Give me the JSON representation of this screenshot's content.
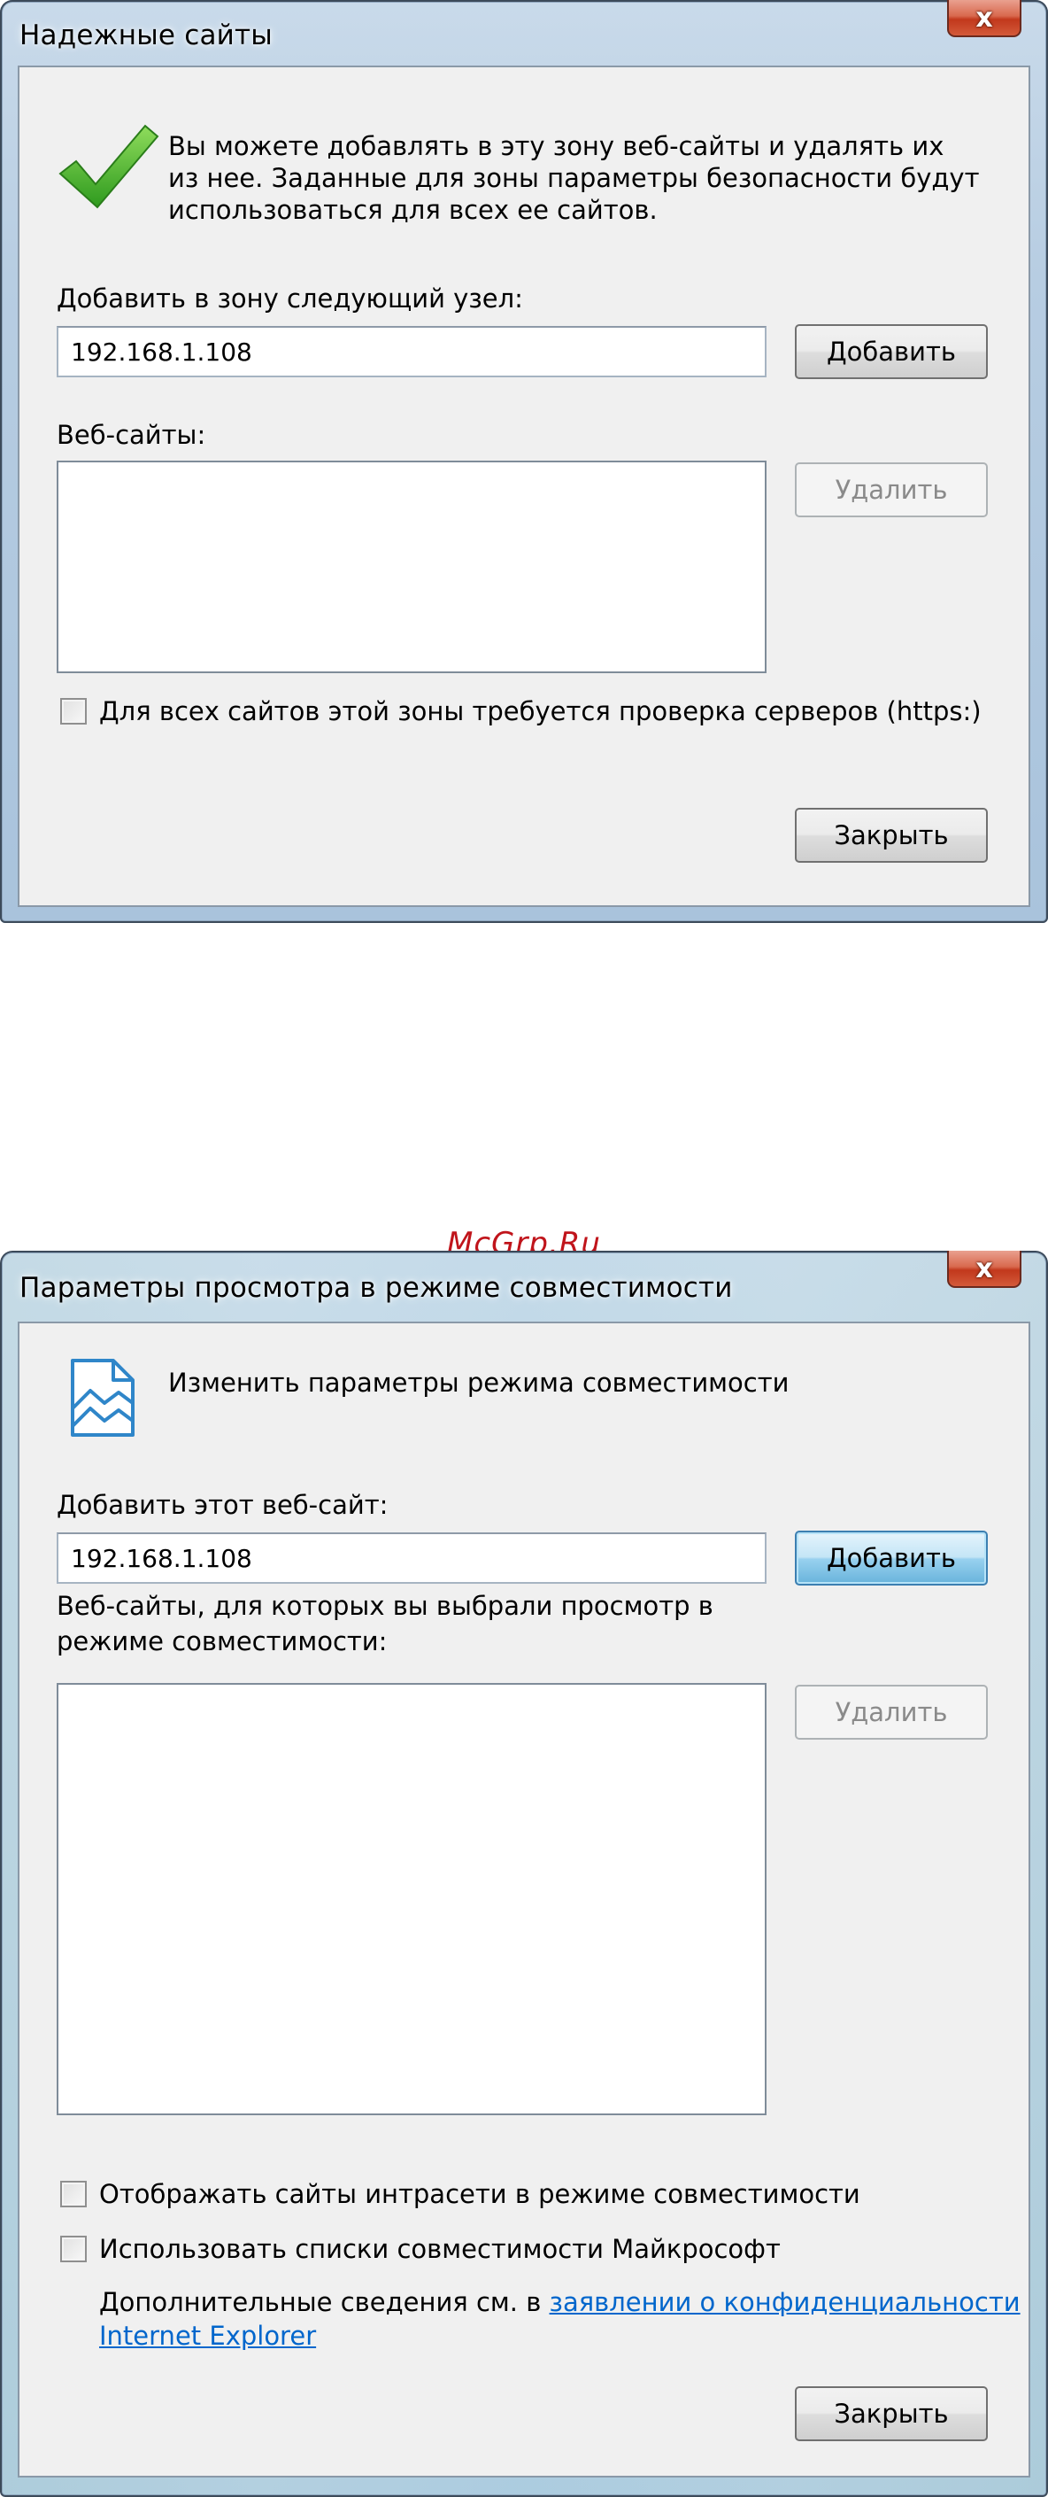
{
  "dialog1": {
    "title": "Надежные сайты",
    "close_glyph": "x",
    "info_line1": "Вы можете добавлять в эту зону  веб-сайты и удалять их",
    "info_line2": "из нее. Заданные для зоны параметры безопасности будут",
    "info_line3": "использоваться для всех ее сайтов.",
    "add_label": "Добавить в зону следующий узел:",
    "add_input_value": "192.168.1.108",
    "add_button": "Добавить",
    "websites_label": "Веб-сайты:",
    "remove_button": "Удалить",
    "https_checkbox_label": "Для всех сайтов этой зоны требуется проверка серверов (https:)",
    "close_button": "Закрыть",
    "icon": "checkmark-icon",
    "accent_color": "#3fa92b"
  },
  "watermark": "McGrp.Ru",
  "dialog2": {
    "title": "Параметры просмотра в режиме совместимости",
    "close_glyph": "x",
    "header_text": "Изменить параметры режима совместимости",
    "add_label": "Добавить этот веб-сайт:",
    "add_input_value": "192.168.1.108",
    "add_button": "Добавить",
    "websites_label_line1": "Веб-сайты, для которых вы выбрали просмотр в",
    "websites_label_line2": "режиме совместимости:",
    "remove_button": "Удалить",
    "intranet_checkbox_label": "Отображать сайты интрасети в режиме совместимости",
    "ms_lists_checkbox_label": "Использовать списки совместимости Майкрософт",
    "more_info_prefix": "Дополнительные сведения см. в ",
    "privacy_link_line1": "заявлении о конфиденциальности",
    "privacy_link_line2": "Internet Explorer",
    "close_button": "Закрыть",
    "icon": "compatibility-page-icon",
    "link_color": "#0066cc"
  }
}
